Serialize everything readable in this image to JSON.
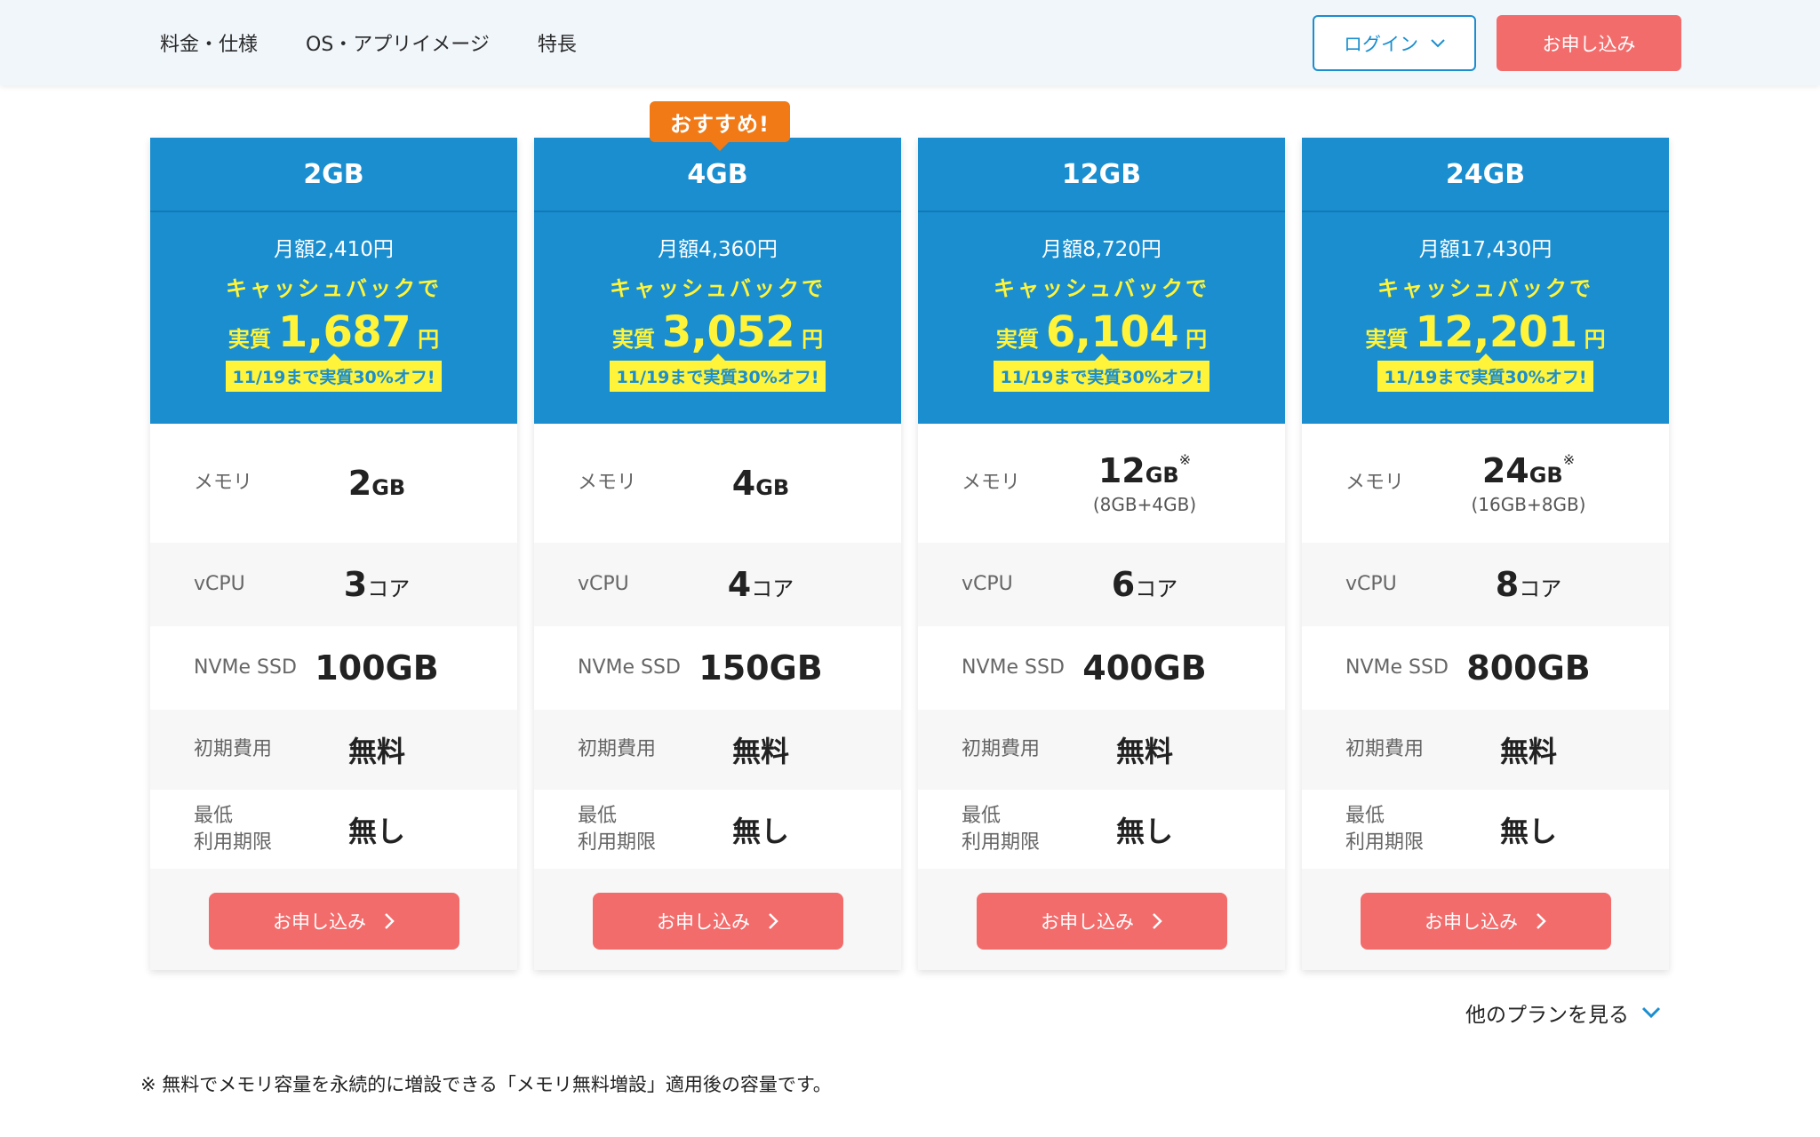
{
  "nav": {
    "items": [
      "料金・仕様",
      "OS・アプリイメージ",
      "特長"
    ],
    "login_label": "ログイン",
    "apply_label": "お申し込み"
  },
  "plans": [
    {
      "name": "2GB",
      "monthly": "月額2,410円",
      "cashback": "キャッシュバックで",
      "effective_prefix": "実質",
      "effective_price": "1,687",
      "effective_unit": "円",
      "promo": "11/19まで実質30%オフ!",
      "badge": "",
      "memory_label": "メモリ",
      "memory_value": "2",
      "memory_unit": "GB",
      "memory_note": "",
      "vcpu_label": "vCPU",
      "vcpu_value": "3",
      "vcpu_unit": "コア",
      "ssd_label": "NVMe SSD",
      "ssd_value": "100GB",
      "initial_label": "初期費用",
      "initial_value": "無料",
      "min_label_1": "最低",
      "min_label_2": "利用期限",
      "min_value": "無し",
      "apply_label": "お申し込み"
    },
    {
      "name": "4GB",
      "monthly": "月額4,360円",
      "cashback": "キャッシュバックで",
      "effective_prefix": "実質",
      "effective_price": "3,052",
      "effective_unit": "円",
      "promo": "11/19まで実質30%オフ!",
      "badge": "おすすめ!",
      "memory_label": "メモリ",
      "memory_value": "4",
      "memory_unit": "GB",
      "memory_note": "",
      "vcpu_label": "vCPU",
      "vcpu_value": "4",
      "vcpu_unit": "コア",
      "ssd_label": "NVMe SSD",
      "ssd_value": "150GB",
      "initial_label": "初期費用",
      "initial_value": "無料",
      "min_label_1": "最低",
      "min_label_2": "利用期限",
      "min_value": "無し",
      "apply_label": "お申し込み"
    },
    {
      "name": "12GB",
      "monthly": "月額8,720円",
      "cashback": "キャッシュバックで",
      "effective_prefix": "実質",
      "effective_price": "6,104",
      "effective_unit": "円",
      "promo": "11/19まで実質30%オフ!",
      "badge": "",
      "memory_label": "メモリ",
      "memory_value": "12",
      "memory_unit": "GB",
      "memory_asterisk": "※",
      "memory_note": "(8GB+4GB)",
      "vcpu_label": "vCPU",
      "vcpu_value": "6",
      "vcpu_unit": "コア",
      "ssd_label": "NVMe SSD",
      "ssd_value": "400GB",
      "initial_label": "初期費用",
      "initial_value": "無料",
      "min_label_1": "最低",
      "min_label_2": "利用期限",
      "min_value": "無し",
      "apply_label": "お申し込み"
    },
    {
      "name": "24GB",
      "monthly": "月額17,430円",
      "cashback": "キャッシュバックで",
      "effective_prefix": "実質",
      "effective_price": "12,201",
      "effective_unit": "円",
      "promo": "11/19まで実質30%オフ!",
      "badge": "",
      "memory_label": "メモリ",
      "memory_value": "24",
      "memory_unit": "GB",
      "memory_asterisk": "※",
      "memory_note": "(16GB+8GB)",
      "vcpu_label": "vCPU",
      "vcpu_value": "8",
      "vcpu_unit": "コア",
      "ssd_label": "NVMe SSD",
      "ssd_value": "800GB",
      "initial_label": "初期費用",
      "initial_value": "無料",
      "min_label_1": "最低",
      "min_label_2": "利用期限",
      "min_value": "無し",
      "apply_label": "お申し込み"
    }
  ],
  "more_plans_label": "他のプランを見る",
  "footnote": "※ 無料でメモリ容量を永続的に増設できる「メモリ無料増設」適用後の容量です。",
  "colors": {
    "primary_blue": "#1a8ecf",
    "accent_yellow": "#fff43a",
    "apply_red": "#f36c6c",
    "badge_orange": "#f17a17"
  }
}
